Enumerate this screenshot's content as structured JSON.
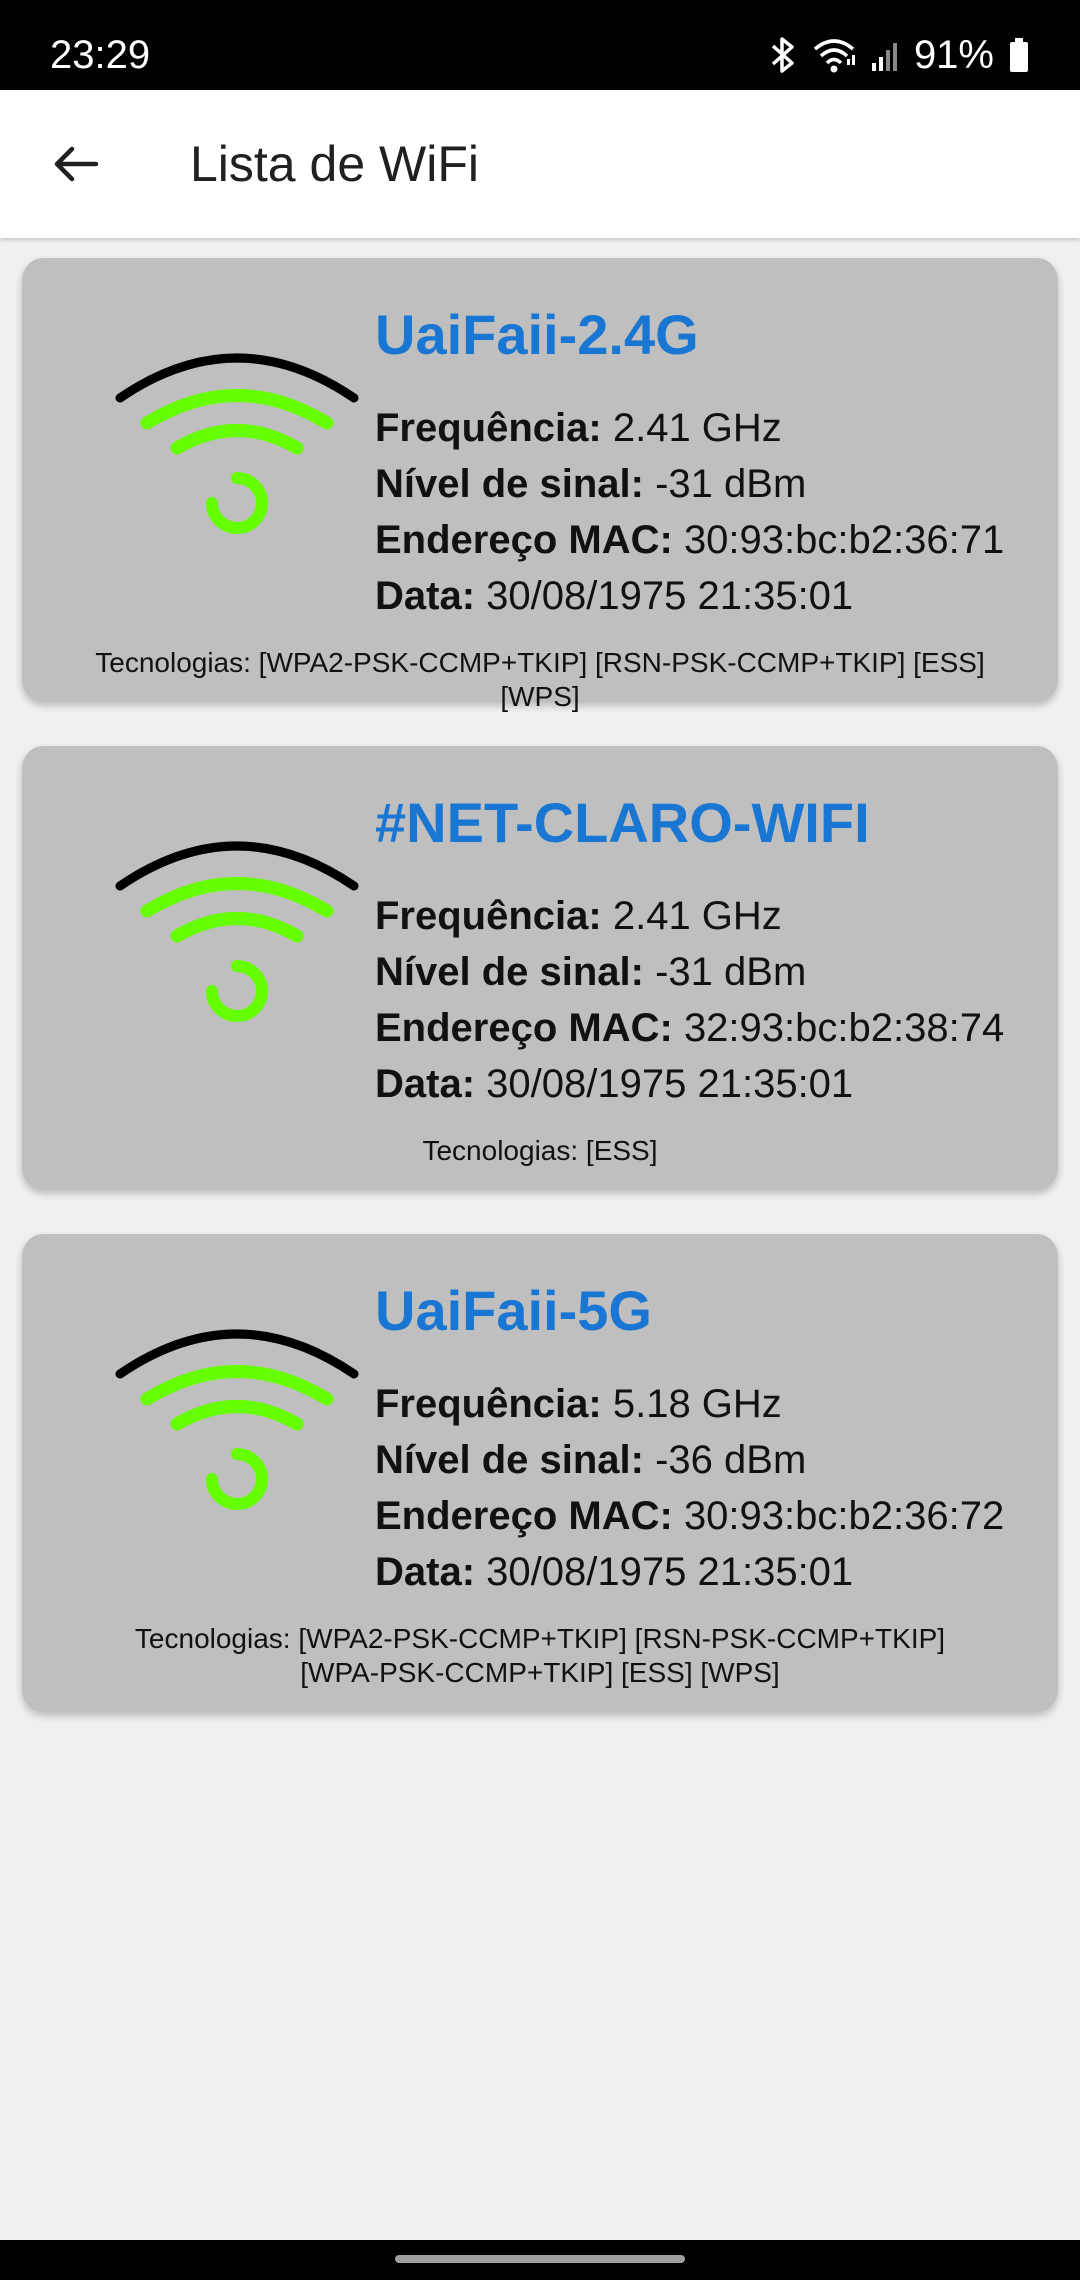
{
  "status": {
    "time": "23:29",
    "battery": "91%",
    "icons": [
      "bluetooth-icon",
      "wifi-status-icon",
      "cell-signal-icon",
      "battery-icon"
    ]
  },
  "app_bar": {
    "back_icon": "arrow-left-icon",
    "title": "Lista de WiFi"
  },
  "labels": {
    "frequency": "Frequência:",
    "signal": "Nível de sinal:",
    "mac": "Endereço MAC:",
    "date": "Data:"
  },
  "networks": [
    {
      "ssid": "UaiFaii-2.4G",
      "frequency": "2.41 GHz",
      "signal": "-31 dBm",
      "mac": "30:93:bc:b2:36:71",
      "date": "30/08/1975 21:35:01",
      "tech_lines": [
        "Tecnologias: [WPA2-PSK-CCMP+TKIP] [RSN-PSK-CCMP+TKIP] [ESS] [WPS]"
      ]
    },
    {
      "ssid": "#NET-CLARO-WIFI",
      "frequency": "2.41 GHz",
      "signal": "-31 dBm",
      "mac": "32:93:bc:b2:38:74",
      "date": "30/08/1975 21:35:01",
      "tech_lines": [
        "Tecnologias: [ESS]"
      ]
    },
    {
      "ssid": "UaiFaii-5G",
      "frequency": "5.18 GHz",
      "signal": "-36 dBm",
      "mac": "30:93:bc:b2:36:72",
      "date": "30/08/1975 21:35:01",
      "tech_lines": [
        "Tecnologias: [WPA2-PSK-CCMP+TKIP] [RSN-PSK-CCMP+TKIP]",
        "[WPA-PSK-CCMP+TKIP] [ESS] [WPS]"
      ]
    }
  ],
  "colors": {
    "ssid": "#1976d2",
    "wifi_outer_arc": "#000000",
    "wifi_inner_arcs": "#66ff00",
    "card_background": "#bfbfbf"
  }
}
